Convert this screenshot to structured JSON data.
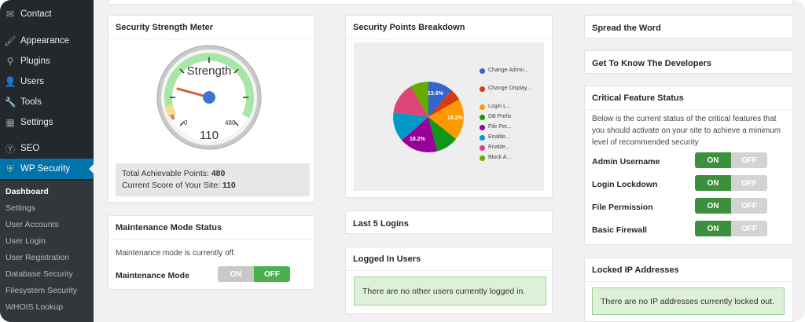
{
  "sidebar": {
    "items": [
      {
        "label": "Contact",
        "icon": "envelope-icon"
      },
      {
        "label": "Appearance",
        "icon": "paintbrush-icon"
      },
      {
        "label": "Plugins",
        "icon": "plugin-icon"
      },
      {
        "label": "Users",
        "icon": "user-icon"
      },
      {
        "label": "Tools",
        "icon": "wrench-icon"
      },
      {
        "label": "Settings",
        "icon": "settings-icon"
      },
      {
        "label": "SEO",
        "icon": "seo-icon"
      },
      {
        "label": "WP Security",
        "icon": "shield-icon"
      }
    ],
    "submenu": [
      "Dashboard",
      "Settings",
      "User Accounts",
      "User Login",
      "User Registration",
      "Database Security",
      "Filesystem Security",
      "WHOIS Lookup"
    ]
  },
  "strength_meter": {
    "title": "Security Strength Meter",
    "gauge_label": "Strength",
    "gauge_min": "0",
    "gauge_max": "480",
    "gauge_value": "110",
    "total_label": "Total Achievable Points:",
    "total_value": "480",
    "current_label": "Current Score of Your Site:",
    "current_value": "110"
  },
  "maintenance": {
    "title": "Maintenance Mode Status",
    "text": "Maintenance mode is currently off.",
    "label": "Maintenance Mode",
    "on_label": "ON",
    "off_label": "OFF"
  },
  "breakdown": {
    "title": "Security Points Breakdown",
    "slice_labels": [
      "13.6%",
      "18.2%",
      "18.2%"
    ],
    "legend": [
      {
        "label": "Change Admin...",
        "color": "#3366cc"
      },
      {
        "label": "Change Display...",
        "color": "#dc3912"
      },
      {
        "label": "Login L...",
        "color": "#ff9900"
      },
      {
        "label": "DB Prefix",
        "color": "#109618"
      },
      {
        "label": "File Per...",
        "color": "#990099"
      },
      {
        "label": "Enable...",
        "color": "#0099c6"
      },
      {
        "label": "Enable...",
        "color": "#dd4477"
      },
      {
        "label": "Block A...",
        "color": "#66aa00"
      }
    ]
  },
  "logins": {
    "title": "Last 5 Logins"
  },
  "logged_in": {
    "title": "Logged In Users",
    "notice": "There are no other users currently logged in."
  },
  "spread": {
    "title": "Spread the Word"
  },
  "developers": {
    "title": "Get To Know The Developers"
  },
  "critical": {
    "title": "Critical Feature Status",
    "description": "Below is the current status of the critical features that you should activate on your site to achieve a minimum level of recommended security",
    "features": [
      {
        "label": "Admin Username",
        "on": "ON",
        "off": "OFF"
      },
      {
        "label": "Login Lockdown",
        "on": "ON",
        "off": "OFF"
      },
      {
        "label": "File Permission",
        "on": "ON",
        "off": "OFF"
      },
      {
        "label": "Basic Firewall",
        "on": "ON",
        "off": "OFF"
      }
    ]
  },
  "locked": {
    "title": "Locked IP Addresses",
    "notice": "There are no IP addresses currently locked out."
  }
}
